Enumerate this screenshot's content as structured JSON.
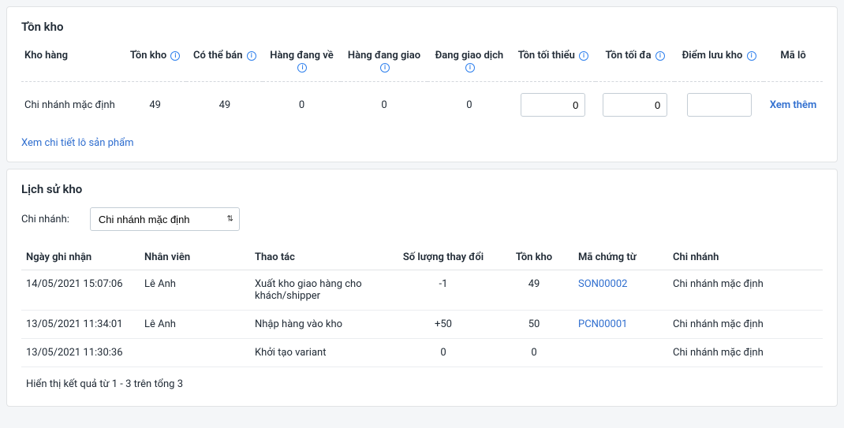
{
  "inventory": {
    "title": "Tồn kho",
    "headers": {
      "warehouse": "Kho hàng",
      "stock": "Tồn kho",
      "sellable": "Có thể bán",
      "incoming": "Hàng đang về",
      "delivering": "Hàng đang giao",
      "trading": "Đang giao dịch",
      "min": "Tồn tối thiểu",
      "max": "Tồn tối đa",
      "storage_point": "Điểm lưu kho",
      "batch": "Mã lô"
    },
    "row": {
      "warehouse": "Chi nhánh mặc định",
      "stock": "49",
      "sellable": "49",
      "incoming": "0",
      "delivering": "0",
      "trading": "0",
      "min": "0",
      "max": "0",
      "storage_point": "",
      "batch_link": "Xem thêm"
    },
    "detail_link": "Xem chi tiết lô sản phẩm"
  },
  "history": {
    "title": "Lịch sử kho",
    "filter_label": "Chi nhánh:",
    "branch_selected": "Chi nhánh mặc định",
    "headers": {
      "date": "Ngày ghi nhận",
      "staff": "Nhân viên",
      "action": "Thao tác",
      "qty": "Số lượng thay đổi",
      "stock": "Tồn kho",
      "doc": "Mã chứng từ",
      "branch": "Chi nhánh"
    },
    "rows": [
      {
        "date": "14/05/2021 15:07:06",
        "staff": "Lê Anh",
        "action": "Xuất kho giao hàng cho khách/shipper",
        "qty": "-1",
        "stock": "49",
        "doc": "SON00002",
        "branch": "Chi nhánh mặc định"
      },
      {
        "date": "13/05/2021 11:34:01",
        "staff": "Lê Anh",
        "action": "Nhập hàng vào kho",
        "qty": "+50",
        "stock": "50",
        "doc": "PCN00001",
        "branch": "Chi nhánh mặc định"
      },
      {
        "date": "13/05/2021 11:30:36",
        "staff": "",
        "action": "Khởi tạo variant",
        "qty": "0",
        "stock": "0",
        "doc": "",
        "branch": "Chi nhánh mặc định"
      }
    ],
    "result_text": "Hiển thị kết quả từ 1 - 3 trên tổng 3"
  }
}
